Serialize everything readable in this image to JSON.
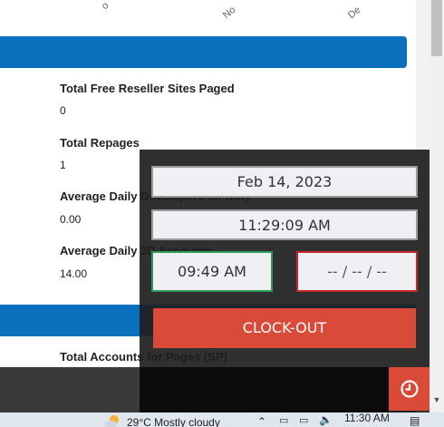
{
  "axis": {
    "label_1": "No",
    "label_2": "De",
    "label_0": "o"
  },
  "stats": [
    {
      "label": "Total Free Reseller Sites Paged",
      "value": "0"
    },
    {
      "label": "Total Repages",
      "value": "1"
    },
    {
      "label": "Average Daily Developers on Duty",
      "value": "0.00"
    },
    {
      "label": "Average Daily 3D Accounts",
      "value": "14.00"
    },
    {
      "label": "Total Accounts for Pages (SP)",
      "value": ""
    }
  ],
  "clock": {
    "date": "Feb 14, 2023",
    "current_time": "11:29:09 AM",
    "clock_in": "09:49 AM",
    "clock_out": "-- / -- / --",
    "button_label": "CLOCK-OUT",
    "accent": "#d94a38"
  },
  "taskbar": {
    "weather": "29°C  Mostly cloudy",
    "time": "11:30 AM"
  }
}
